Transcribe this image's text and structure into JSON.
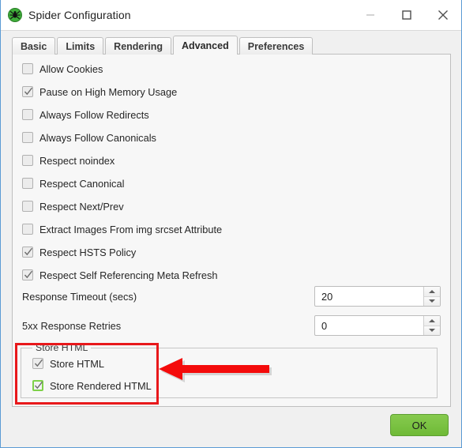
{
  "window": {
    "title": "Spider Configuration",
    "app_icon": "spider-icon",
    "accent_border": "#5b9bd5",
    "controls": {
      "minimize": "minimize-icon",
      "maximize": "maximize-icon",
      "close": "close-icon"
    }
  },
  "tabs": [
    {
      "label": "Basic",
      "selected": false
    },
    {
      "label": "Limits",
      "selected": false
    },
    {
      "label": "Rendering",
      "selected": false
    },
    {
      "label": "Advanced",
      "selected": true
    },
    {
      "label": "Preferences",
      "selected": false
    }
  ],
  "checkboxes": [
    {
      "label": "Allow Cookies",
      "checked": false,
      "highlighted": false
    },
    {
      "label": "Pause on High Memory Usage",
      "checked": true,
      "highlighted": false
    },
    {
      "label": "Always Follow Redirects",
      "checked": false,
      "highlighted": false
    },
    {
      "label": "Always Follow Canonicals",
      "checked": false,
      "highlighted": false
    },
    {
      "label": "Respect noindex",
      "checked": false,
      "highlighted": false
    },
    {
      "label": "Respect Canonical",
      "checked": false,
      "highlighted": false
    },
    {
      "label": "Respect Next/Prev",
      "checked": false,
      "highlighted": false
    },
    {
      "label": "Extract Images From img srcset Attribute",
      "checked": false,
      "highlighted": false
    },
    {
      "label": "Respect HSTS Policy",
      "checked": true,
      "highlighted": false
    },
    {
      "label": "Respect Self Referencing Meta Refresh",
      "checked": true,
      "highlighted": false
    }
  ],
  "spinners": [
    {
      "label": "Response Timeout (secs)",
      "value": "20"
    },
    {
      "label": "5xx Response Retries",
      "value": "0"
    }
  ],
  "store_group": {
    "title": "Store HTML",
    "items": [
      {
        "label": "Store HTML",
        "checked": true,
        "highlighted": false
      },
      {
        "label": "Store Rendered HTML",
        "checked": true,
        "highlighted": true
      }
    ],
    "highlight_color": "#7fd14a"
  },
  "annotations": {
    "highlight_box": {
      "name": "red-highlight-box",
      "color": "#e8181b"
    },
    "arrow": {
      "name": "red-arrow-pointing-left",
      "color": "#f40b0b",
      "direction": "left"
    }
  },
  "footer": {
    "ok_label": "OK",
    "ok_color": "#79c241"
  }
}
